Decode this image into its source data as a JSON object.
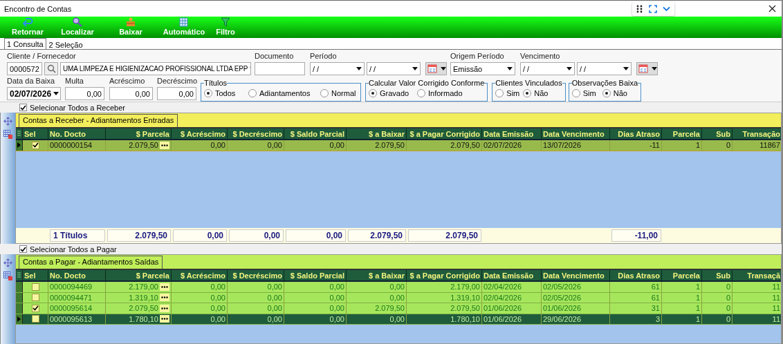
{
  "window": {
    "title": "Encontro de Contas"
  },
  "toolbar": [
    {
      "label": "Retornar"
    },
    {
      "label": "Localizar"
    },
    {
      "label": "Baixar"
    },
    {
      "label": "Automático"
    },
    {
      "label": "Filtro"
    }
  ],
  "tabs": [
    {
      "label": "1 Consulta",
      "selected": true
    },
    {
      "label": "2 Seleção",
      "selected": false
    }
  ],
  "filters": {
    "cliente": {
      "label": "Cliente / Fornecedor",
      "code": "0000572",
      "name": "UMA LIMPEZA E HIGIENIZACAO PROFISSIONAL LTDA EPP"
    },
    "documento": {
      "label": "Documento"
    },
    "periodo": {
      "label": "Período",
      "from": "/ /",
      "to": "/ /"
    },
    "origem": {
      "label": "Origem Período",
      "value": "Emissão"
    },
    "vencimento": {
      "label": "Vencimento",
      "from": "/ /",
      "to": "/ /"
    },
    "data_baixa": {
      "label": "Data da Baixa",
      "value": "02/07/2026"
    },
    "amounts": [
      {
        "label": "Multa",
        "value": "0,00"
      },
      {
        "label": "Acréscimo",
        "value": "0,00"
      },
      {
        "label": "Decréscimo",
        "value": "0,00"
      }
    ],
    "groups": [
      {
        "title": "Títulos",
        "options": [
          {
            "label": "Todos",
            "selected": true
          },
          {
            "label": "Adiantamentos",
            "selected": false
          },
          {
            "label": "Normal",
            "selected": false
          }
        ]
      },
      {
        "title": "Calcular Valor Corrigido Conforme",
        "options": [
          {
            "label": "Gravado",
            "selected": true
          },
          {
            "label": "Informado",
            "selected": false
          }
        ]
      },
      {
        "title": "Clientes Vinculados",
        "options": [
          {
            "label": "Sim",
            "selected": false
          },
          {
            "label": "Não",
            "selected": true
          }
        ]
      },
      {
        "title": "Observações Baixa",
        "options": [
          {
            "label": "Sim",
            "selected": false
          },
          {
            "label": "Não",
            "selected": true
          }
        ]
      }
    ]
  },
  "grids": [
    {
      "select_all": {
        "label": "Selecionar Todos a Receber",
        "checked": true
      },
      "tab": "Contas a Receber - Adiantamentos Entradas",
      "kind": "receber",
      "sel_column": "Sel",
      "columns": [
        "No. Docto",
        "$ Parcela",
        "$ Acréscimo",
        "$ Decréscimo",
        "$ Saldo Parcial",
        "$ a Baixar",
        "$ a Pagar Corrigido",
        "Data Emissão",
        "Data Vencimento",
        "Dias Atraso",
        "Parcela",
        "Sub",
        "Transação"
      ],
      "rows": [
        {
          "selected": true,
          "checked": true,
          "cells": [
            "0000000154",
            "2.079,50",
            "0,00",
            "0,00",
            "0,00",
            "2.079,50",
            "2.079,50",
            "02/07/2026",
            "13/07/2026",
            "-11",
            "1",
            "0",
            "11867"
          ]
        }
      ],
      "totals": [
        "1 Títulos",
        "2.079,50",
        "0,00",
        "0,00",
        "0,00",
        "2.079,50",
        "2.079,50"
      ],
      "total_dias_atraso": "-11,00"
    },
    {
      "select_all": {
        "label": "Selecionar Todos a Pagar",
        "checked": true
      },
      "tab": "Contas a Pagar - Adiantamentos Saídas",
      "kind": "pagar",
      "sel_column": "Sel",
      "columns": [
        "No. Docto",
        "$ Parcela",
        "$ Acréscimo",
        "$ Decréscimo",
        "$ Saldo Parcial",
        "$ a Baixar",
        "$ a Pagar Corrigido",
        "Data Emissão",
        "Data Vencimento",
        "Dias Atraso",
        "Parcela",
        "Sub",
        "Transaçã"
      ],
      "rows": [
        {
          "selected": false,
          "checked": false,
          "cells": [
            "0000094469",
            "2.179,00",
            "0,00",
            "0,00",
            "0,00",
            "0,00",
            "2.179,00",
            "02/04/2026",
            "02/05/2026",
            "61",
            "1",
            "0",
            "11"
          ]
        },
        {
          "selected": false,
          "checked": false,
          "cells": [
            "0000094471",
            "1.319,10",
            "0,00",
            "0,00",
            "0,00",
            "0,00",
            "1.319,10",
            "02/04/2026",
            "02/05/2026",
            "61",
            "1",
            "0",
            "11"
          ]
        },
        {
          "selected": false,
          "checked": true,
          "cells": [
            "0000095614",
            "2.079,50",
            "0,00",
            "0,00",
            "0,00",
            "2.079,50",
            "2.079,50",
            "01/06/2026",
            "01/06/2026",
            "31",
            "1",
            "0",
            "11"
          ]
        },
        {
          "selected": true,
          "checked": false,
          "cells": [
            "0000095613",
            "1.780,10",
            "0,00",
            "0,00",
            "0,00",
            "0,00",
            "1.780,10",
            "01/06/2026",
            "29/06/2026",
            "3",
            "1",
            "0",
            "11"
          ]
        }
      ]
    }
  ]
}
